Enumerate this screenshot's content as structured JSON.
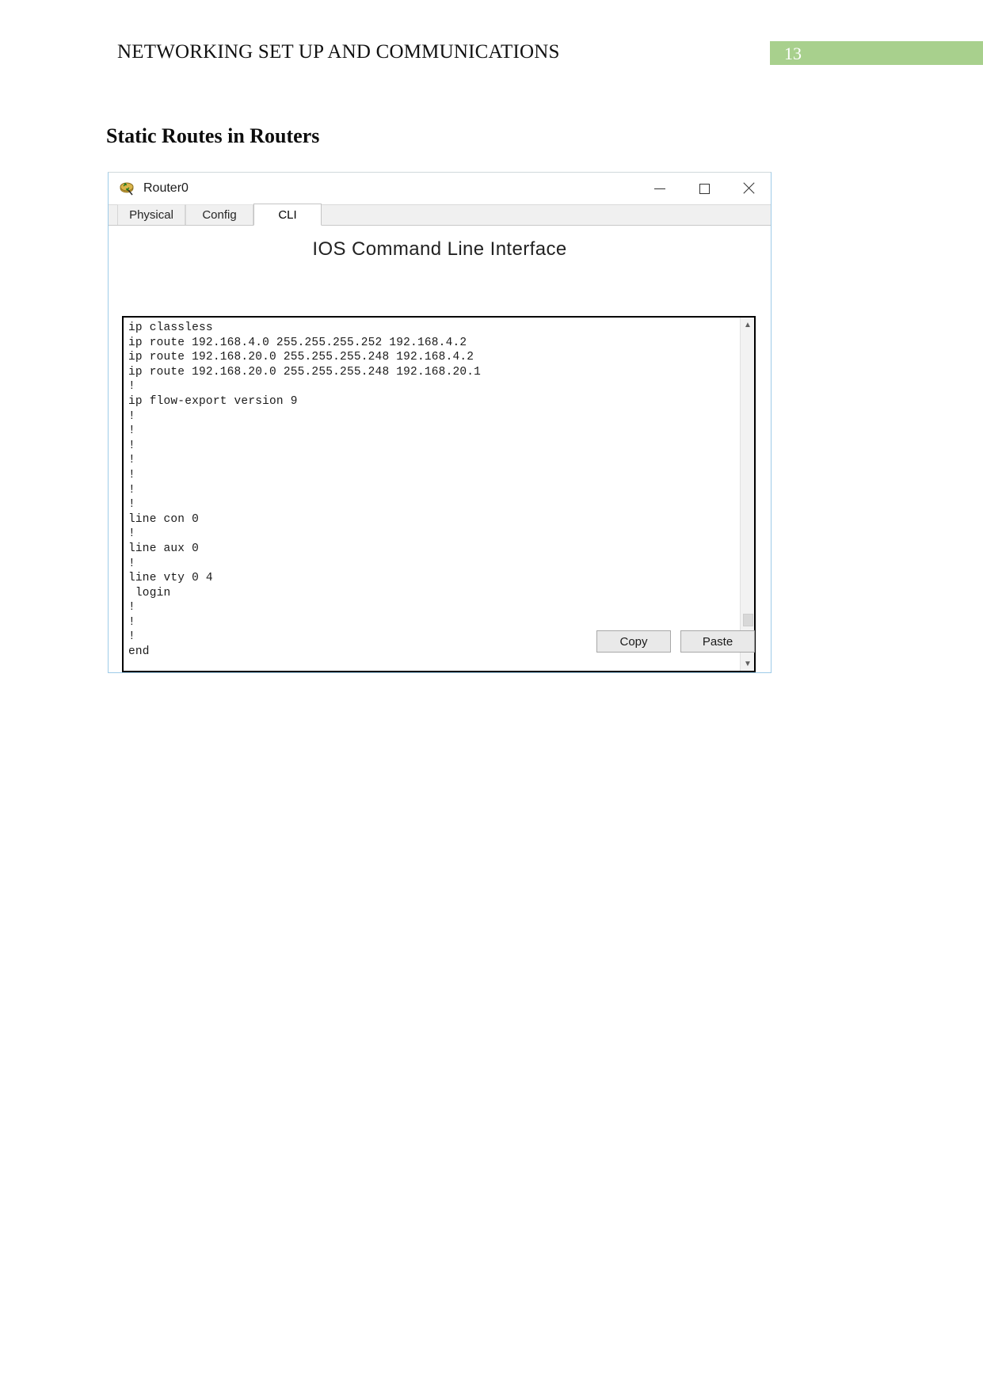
{
  "document": {
    "header_title": "NETWORKING SET UP AND COMMUNICATIONS",
    "page_number": "13",
    "page_badge_color": "#a8d08d",
    "section_heading": "Static Routes in Routers"
  },
  "window": {
    "title": "Router0",
    "icon": "router-icon",
    "controls": {
      "minimize": "minimize-icon",
      "maximize": "maximize-icon",
      "close": "close-icon"
    },
    "tabs": [
      {
        "label": "Physical",
        "active": false
      },
      {
        "label": "Config",
        "active": false
      },
      {
        "label": "CLI",
        "active": true
      }
    ],
    "cli": {
      "title": "IOS Command Line Interface",
      "console_text": "ip classless\nip route 192.168.4.0 255.255.255.252 192.168.4.2\nip route 192.168.20.0 255.255.255.248 192.168.4.2\nip route 192.168.20.0 255.255.255.248 192.168.20.1\n!\nip flow-export version 9\n!\n!\n!\n!\n!\n!\n!\nline con 0\n!\nline aux 0\n!\nline vty 0 4\n login\n!\n!\n!\nend",
      "scroll_up_icon": "chevron-up-icon",
      "scroll_down_icon": "chevron-down-icon"
    },
    "buttons": {
      "copy": "Copy",
      "paste": "Paste"
    }
  }
}
